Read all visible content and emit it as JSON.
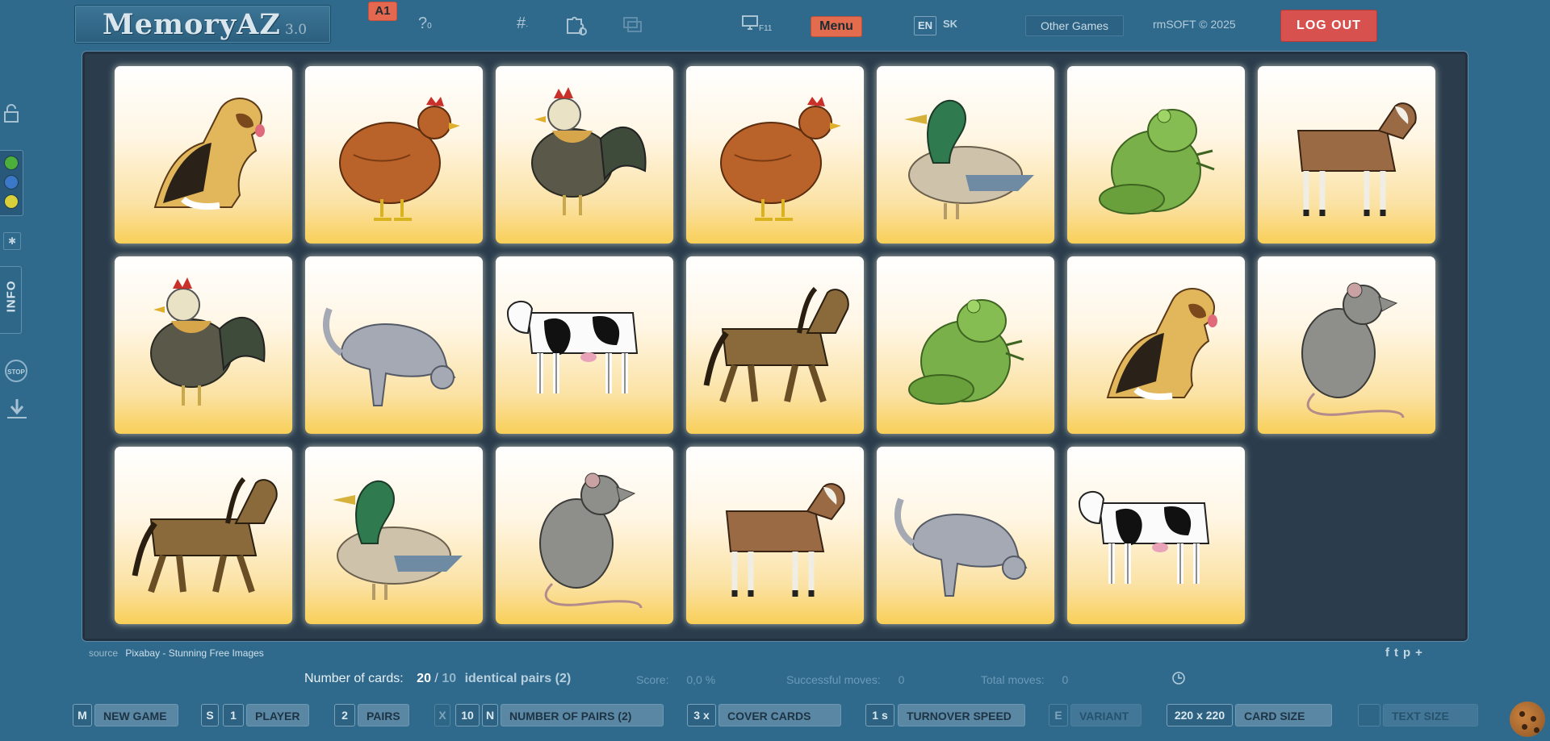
{
  "header": {
    "logo_text": "MemoryAZ",
    "version": "3.0",
    "level_badge": "A1",
    "help_count": "0",
    "fullscreen_key": "F11",
    "menu_label": "Menu",
    "lang_en": "EN",
    "lang_sk": "SK",
    "other_games": "Other Games",
    "copyright": "rmSOFT © 2025",
    "logout": "LOG OUT"
  },
  "sidebar": {
    "info_label": "INFO",
    "stop_label": "STOP",
    "colors": [
      "#4caf3b",
      "#3c78c8",
      "#d8cf3a"
    ]
  },
  "board": {
    "cards": [
      {
        "animal": "dog"
      },
      {
        "animal": "hen"
      },
      {
        "animal": "rooster"
      },
      {
        "animal": "hen"
      },
      {
        "animal": "duck"
      },
      {
        "animal": "frog"
      },
      {
        "animal": "goat"
      },
      {
        "animal": "rooster"
      },
      {
        "animal": "cat"
      },
      {
        "animal": "cow"
      },
      {
        "animal": "horse"
      },
      {
        "animal": "frog"
      },
      {
        "animal": "dog"
      },
      {
        "animal": "rat"
      },
      {
        "animal": "horse"
      },
      {
        "animal": "duck"
      },
      {
        "animal": "rat"
      },
      {
        "animal": "goat"
      },
      {
        "animal": "cat"
      },
      {
        "animal": "cow"
      }
    ]
  },
  "footer": {
    "source_label": "source",
    "source_value": "Pixabay - Stunning Free Images",
    "social_icons": [
      "facebook-icon",
      "twitter-icon",
      "pinterest-icon",
      "plus-icon"
    ]
  },
  "stats": {
    "cards_label": "Number of cards:",
    "cards_count": "20",
    "cards_sep": "/",
    "pairs_count": "10",
    "pairs_text": "identical pairs (2)",
    "score_label": "Score:",
    "score_value": "0,0 %",
    "successful_label": "Successful moves:",
    "successful_value": "0",
    "total_label": "Total moves:",
    "total_value": "0"
  },
  "controls": {
    "m_key": "M",
    "new_game": "NEW GAME",
    "s_key": "S",
    "player_count": "1",
    "player": "PLAYER",
    "pairs_value": "2",
    "pairs": "PAIRS",
    "x_key": "X",
    "pairs_number": "10",
    "n_key": "N",
    "number_of_pairs": "NUMBER OF PAIRS (2)",
    "cover_value": "3 x",
    "cover_cards": "COVER CARDS",
    "speed_value": "1 s",
    "turnover_speed": "TURNOVER SPEED",
    "e_key": "E",
    "variant": "VARIANT",
    "card_size_value": "220 x 220",
    "card_size": "CARD SIZE",
    "text_size": "TEXT SIZE"
  }
}
